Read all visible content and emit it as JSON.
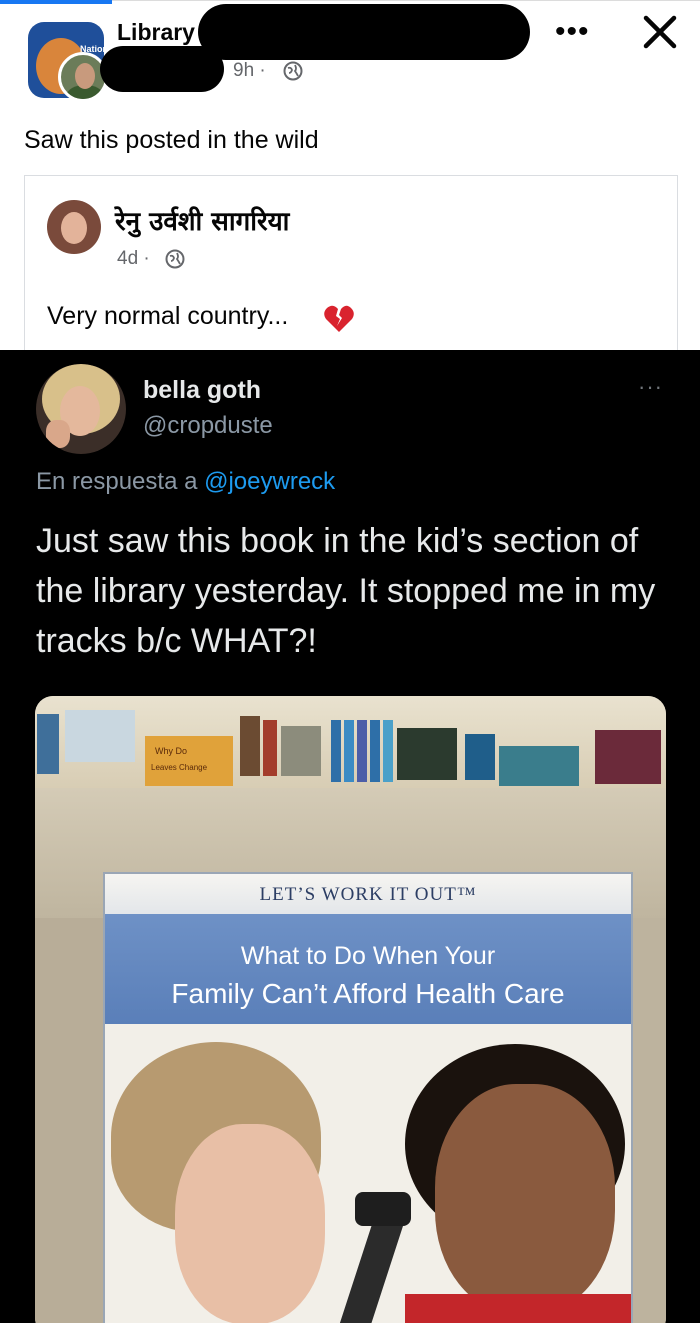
{
  "post": {
    "group_name": "Library",
    "group_avatar_text": "Nationa",
    "time": "9h ·",
    "text": "Saw this posted in the wild"
  },
  "shared": {
    "author": "रेनु उर्वशी सागरिया",
    "time": "4d ·",
    "text": "Very normal country..."
  },
  "tweet": {
    "name": "bella goth",
    "handle": "@cropduste",
    "reply_prefix": "En respuesta a",
    "reply_mention": "@joeywreck",
    "text": "Just saw this book in the kid’s section of the library yesterday. It stopped me in my tracks b/c WHAT?!",
    "more": "···"
  },
  "book": {
    "series": "LET’S WORK IT OUT™",
    "title_line1": "What to Do When Your",
    "title_line2": "Family Can’t Afford Health Care",
    "shelf_label1": "Why Do",
    "shelf_label2": "Leaves Change"
  },
  "colors": {
    "fb_blue": "#1877f2",
    "tweet_bg": "#000000",
    "mention": "#1d9bf0"
  },
  "icons": [
    "globe-icon",
    "more-icon",
    "close-icon",
    "broken-heart-icon"
  ]
}
